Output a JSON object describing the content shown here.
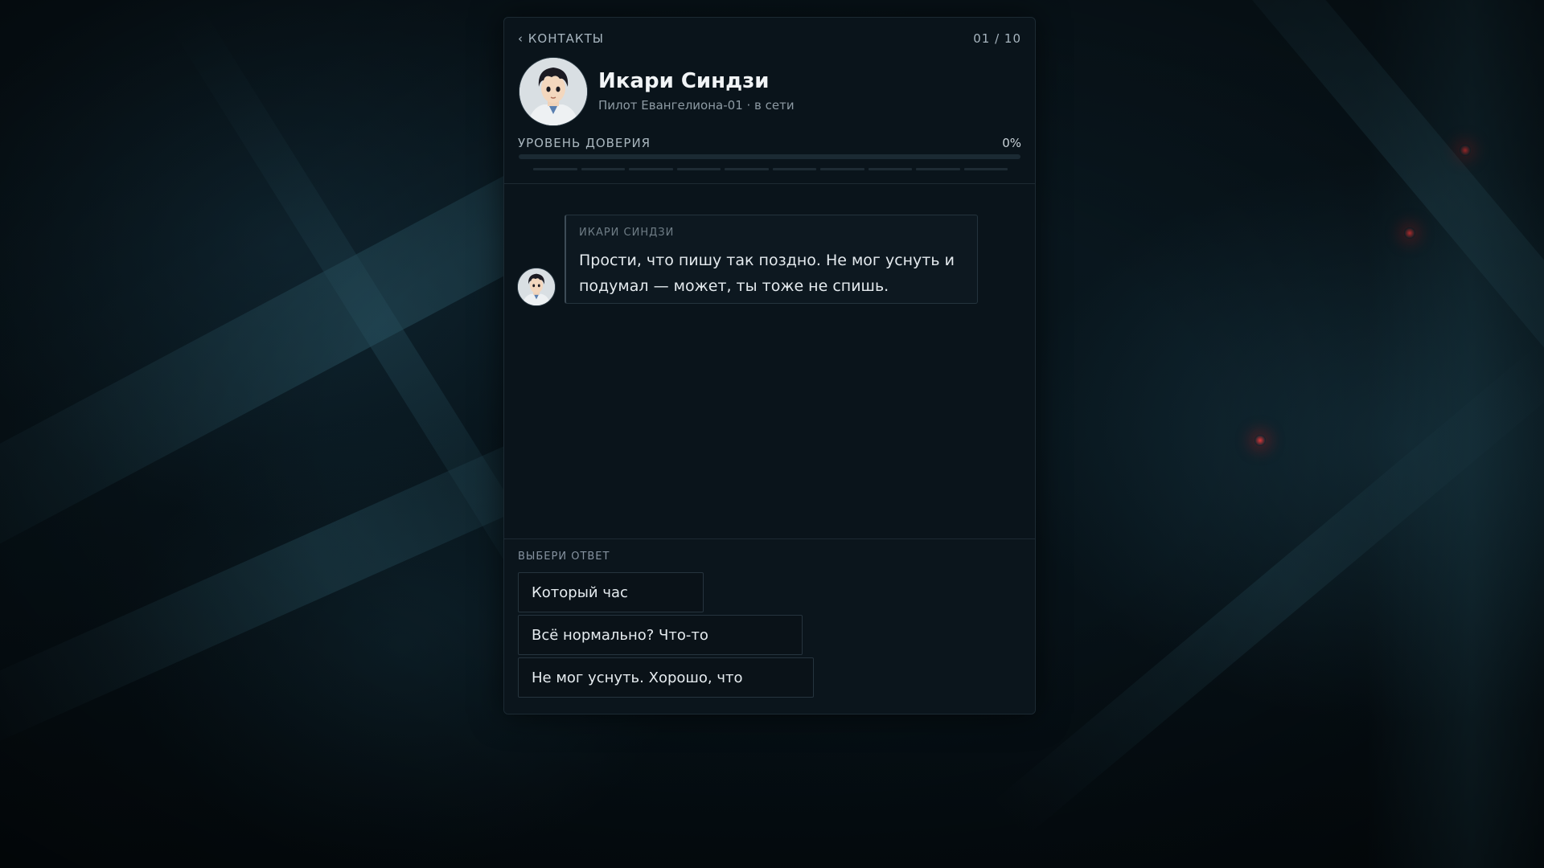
{
  "header": {
    "back_label": "‹ КОНТАКТЫ",
    "counter": "01 / 10"
  },
  "contact": {
    "name": "Икари Синдзи",
    "subtitle": "Пилот Евангелиона-01 · в сети"
  },
  "trust": {
    "label": "УРОВЕНЬ ДОВЕРИЯ",
    "percent_label": "0%",
    "percent_value": 0,
    "segments": 10
  },
  "messages": [
    {
      "sender": "ИКАРИ СИНДЗИ",
      "text": "Прости, что пишу так поздно. Не мог уснуть и подумал — может, ты тоже не спишь."
    }
  ],
  "reply": {
    "label": "ВЫБЕРИ ОТВЕТ",
    "options": [
      "Который час вообще.",
      "Всё нормально? Что-то случилось?",
      "Не мог уснуть. Хорошо, что написал."
    ]
  },
  "colors": {
    "panel_bg": "#0a141b",
    "accent": "#5fa8c7",
    "text_primary": "#f1f4f6",
    "text_muted": "#8d9aa3"
  },
  "icons": {
    "avatar": "shinji-portrait-avatar"
  }
}
